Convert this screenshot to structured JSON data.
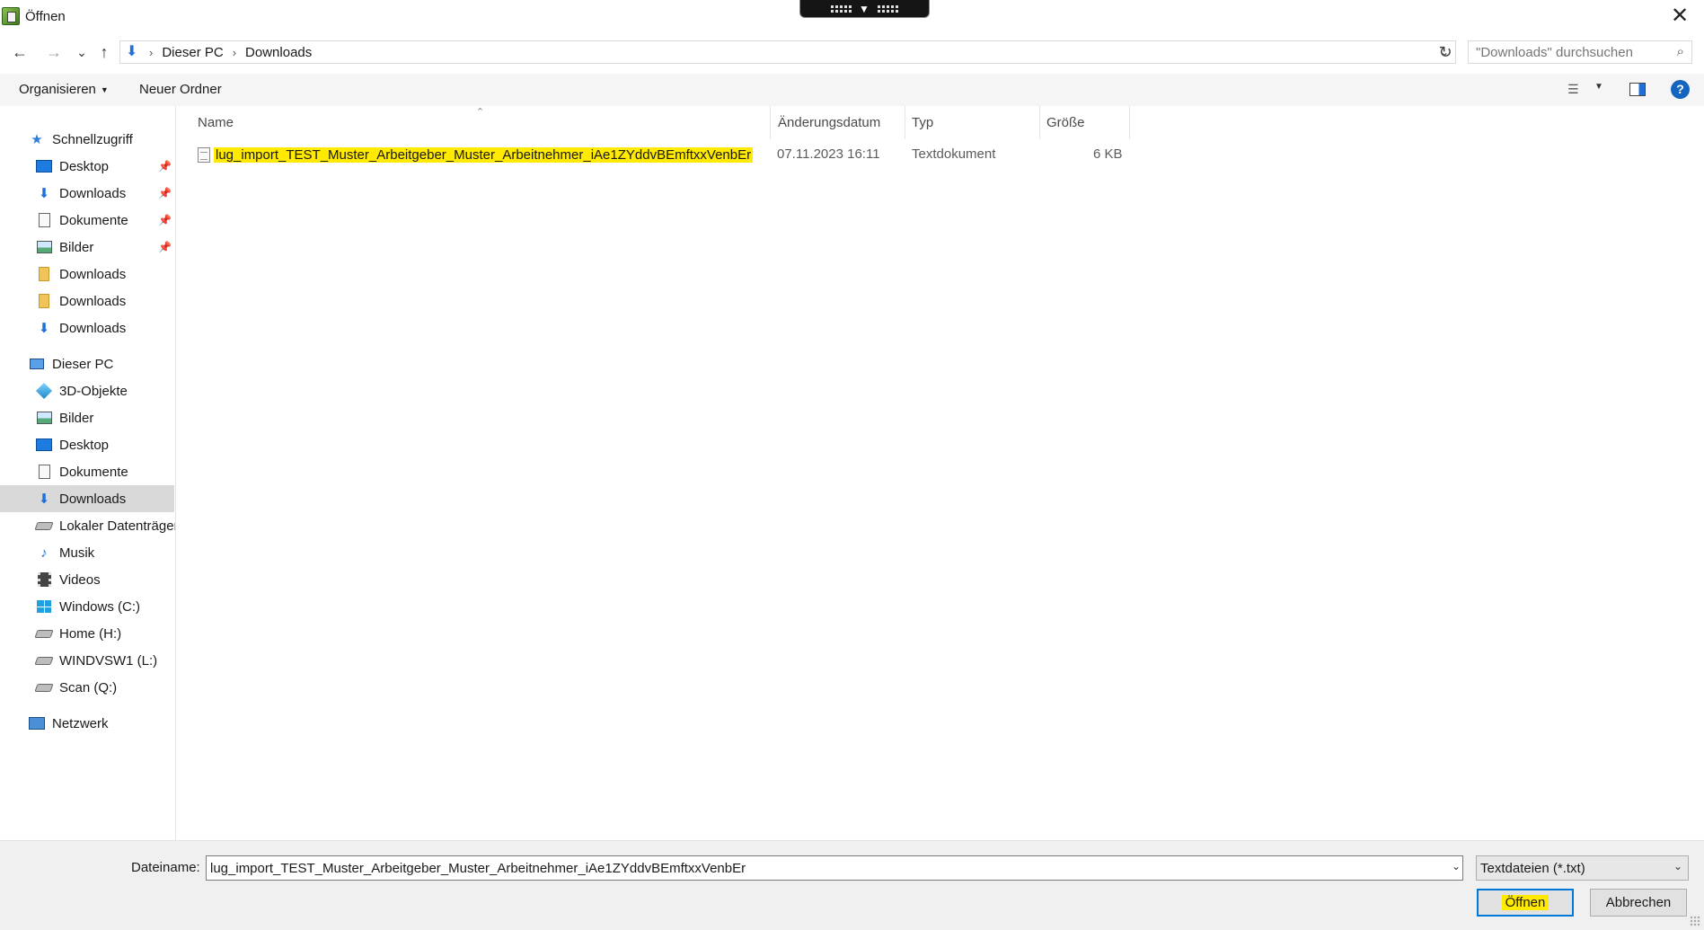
{
  "window": {
    "title": "Öffnen",
    "close_glyph": "✕"
  },
  "nav": {
    "back_glyph": "←",
    "forward_glyph": "→",
    "recent_glyph": "⌄",
    "up_glyph": "↑",
    "breadcrumb": [
      "Dieser PC",
      "Downloads"
    ],
    "refresh_glyph": "↻",
    "search_placeholder": "\"Downloads\" durchsuchen"
  },
  "command_bar": {
    "organize_label": "Organisieren",
    "new_folder_label": "Neuer Ordner",
    "help_label": "?"
  },
  "sidebar": {
    "quick_access_label": "Schnellzugriff",
    "quick_access_items": [
      {
        "label": "Desktop",
        "icon": "desktop-icon",
        "pinned": true
      },
      {
        "label": "Downloads",
        "icon": "download-arrow-icon",
        "pinned": true
      },
      {
        "label": "Dokumente",
        "icon": "documents-icon",
        "pinned": true
      },
      {
        "label": "Bilder",
        "icon": "pictures-icon",
        "pinned": true
      },
      {
        "label": "Downloads",
        "icon": "folder-icon",
        "pinned": false
      },
      {
        "label": "Downloads",
        "icon": "folder-icon",
        "pinned": false
      },
      {
        "label": "Downloads",
        "icon": "download-arrow-icon",
        "pinned": false
      }
    ],
    "this_pc_label": "Dieser PC",
    "this_pc_items": [
      {
        "label": "3D-Objekte",
        "icon": "3d-objects-icon"
      },
      {
        "label": "Bilder",
        "icon": "pictures-icon"
      },
      {
        "label": "Desktop",
        "icon": "desktop-icon"
      },
      {
        "label": "Dokumente",
        "icon": "documents-icon"
      },
      {
        "label": "Downloads",
        "icon": "download-arrow-icon",
        "selected": true
      },
      {
        "label": "Lokaler Datenträger",
        "icon": "drive-icon"
      },
      {
        "label": "Musik",
        "icon": "music-icon"
      },
      {
        "label": "Videos",
        "icon": "videos-icon"
      },
      {
        "label": "Windows (C:)",
        "icon": "windows-drive-icon"
      },
      {
        "label": "Home (H:)",
        "icon": "network-drive-icon"
      },
      {
        "label": "WINDVSW1 (L:)",
        "icon": "network-drive-icon"
      },
      {
        "label": "Scan (Q:)",
        "icon": "network-drive-icon"
      }
    ],
    "network_label": "Netzwerk"
  },
  "file_list": {
    "columns": [
      "Name",
      "Änderungsdatum",
      "Typ",
      "Größe"
    ],
    "files": [
      {
        "name": "lug_import_TEST_Muster_Arbeitgeber_Muster_Arbeitnehmer_iAe1ZYddvBEmftxxVenbEr",
        "modified": "07.11.2023 16:11",
        "type": "Textdokument",
        "size": "6 KB",
        "highlight_color": "#ffea00"
      }
    ]
  },
  "footer": {
    "filename_label": "Dateiname:",
    "filename_value": "lug_import_TEST_Muster_Arbeitgeber_Muster_Arbeitnehmer_iAe1ZYddvBEmftxxVenbEr",
    "filter_value": "Textdateien (*.txt)",
    "open_button": "Öffnen",
    "cancel_button": "Abbrechen"
  },
  "colors": {
    "accent": "#0078d7",
    "highlight": "#ffea00",
    "selected_bg": "#d9d9d9"
  }
}
